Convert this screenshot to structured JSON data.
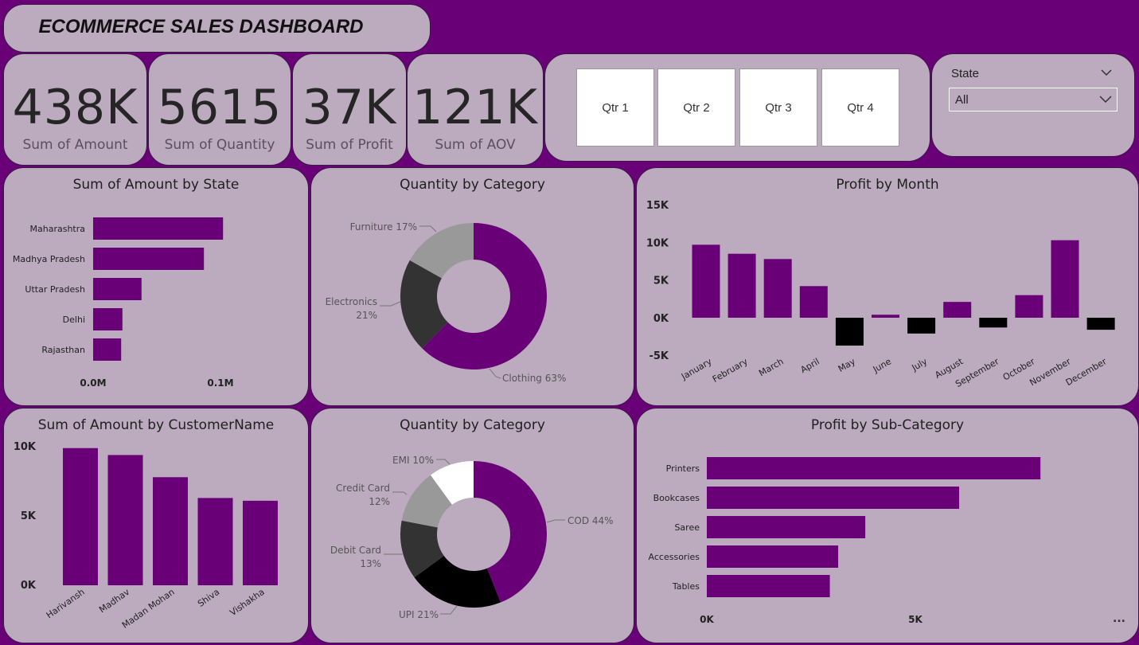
{
  "title": "ECOMMERCE SALES DASHBOARD",
  "kpis": [
    {
      "value": "438K",
      "label": "Sum of Amount"
    },
    {
      "value": "5615",
      "label": "Sum of Quantity"
    },
    {
      "value": "37K",
      "label": "Sum of Profit"
    },
    {
      "value": "121K",
      "label": "Sum of AOV"
    }
  ],
  "quarters": [
    "Qtr 1",
    "Qtr 2",
    "Qtr 3",
    "Qtr 4"
  ],
  "state_filter": {
    "label": "State",
    "value": "All"
  },
  "more_options": "...",
  "colors": {
    "purple": "#6a0078",
    "card": "#bcaabe",
    "dark": "#333333",
    "black": "#000000",
    "grey": "#999999",
    "white": "#ffffff"
  },
  "icons": {
    "state_header": "chevron-down-icon",
    "state_select": "chevron-down-icon",
    "more": "more-options-icon"
  },
  "chart_data": [
    {
      "type": "bar",
      "orientation": "horizontal",
      "title": "Sum of Amount by State",
      "categories": [
        "Maharashtra",
        "Madhya Pradesh",
        "Uttar Pradesh",
        "Delhi",
        "Rajasthan"
      ],
      "values": [
        0.102,
        0.087,
        0.038,
        0.023,
        0.022
      ],
      "xticks": [
        "0.0M",
        "0.1M"
      ],
      "xlim": [
        0,
        0.1
      ],
      "color": "#6a0078"
    },
    {
      "type": "pie",
      "donut": true,
      "title": "Quantity by Category",
      "categories": [
        "Clothing",
        "Electronics",
        "Furniture"
      ],
      "values": [
        63,
        21,
        17
      ],
      "labels": [
        "Clothing 63%",
        "Electronics 21%",
        "Furniture 17%"
      ],
      "colors": [
        "#6a0078",
        "#333333",
        "#999999"
      ]
    },
    {
      "type": "bar",
      "title": "Profit by Month",
      "categories": [
        "January",
        "February",
        "March",
        "April",
        "May",
        "June",
        "July",
        "August",
        "September",
        "October",
        "November",
        "December"
      ],
      "values": [
        9700,
        8500,
        7800,
        4200,
        -3700,
        400,
        -2100,
        2100,
        -1300,
        3000,
        10300,
        -1600
      ],
      "yticks": [
        "15K",
        "10K",
        "5K",
        "0K",
        "-5K"
      ],
      "ylim": [
        -5000,
        15000
      ],
      "colors": {
        "positive": "#6a0078",
        "negative": "#000000"
      }
    },
    {
      "type": "bar",
      "title": "Sum of Amount by CustomerName",
      "categories": [
        "Harivansh",
        "Madhav",
        "Madan Mohan",
        "Shiva",
        "Vishakha"
      ],
      "values": [
        9900,
        9400,
        7800,
        6300,
        6100
      ],
      "yticks": [
        "10K",
        "5K",
        "0K"
      ],
      "ylim": [
        0,
        10000
      ],
      "color": "#6a0078"
    },
    {
      "type": "pie",
      "donut": true,
      "title": "Quantity by Category",
      "categories": [
        "COD",
        "UPI",
        "Debit Card",
        "Credit Card",
        "EMI"
      ],
      "values": [
        44,
        21,
        13,
        12,
        10
      ],
      "labels": [
        "COD 44%",
        "UPI 21%",
        "Debit Card 13%",
        "Credit Card 12%",
        "EMI 10%"
      ],
      "colors": [
        "#6a0078",
        "#000000",
        "#333333",
        "#999999",
        "#ffffff"
      ]
    },
    {
      "type": "bar",
      "orientation": "horizontal",
      "title": "Profit by Sub-Category",
      "categories": [
        "Printers",
        "Bookcases",
        "Saree",
        "Accessories",
        "Tables"
      ],
      "values": [
        8000,
        6050,
        3800,
        3150,
        2950
      ],
      "xticks": [
        "0K",
        "5K"
      ],
      "xlim": [
        0,
        5000
      ],
      "color": "#6a0078"
    }
  ]
}
